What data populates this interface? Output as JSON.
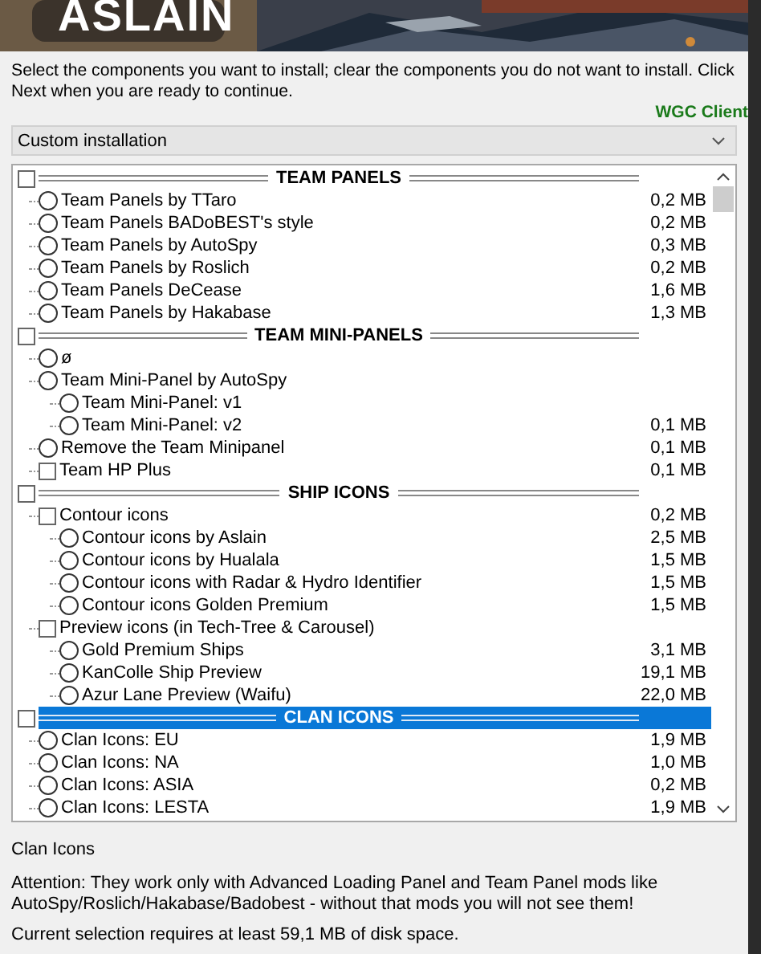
{
  "banner": {
    "kind": "picture",
    "logo": "ASLAIN"
  },
  "instructions": "Select the components you want to install; clear the components you do not want to install. Click Next when you are ready to continue.",
  "client_label": "WGC Client",
  "install_type": {
    "value": "Custom installation"
  },
  "components": [
    {
      "kind": "header",
      "label": "TEAM PANELS",
      "checked": false,
      "selected": false,
      "children": [
        {
          "kind": "radio",
          "label": "Team Panels by TTaro",
          "size": "0,2 MB",
          "checked": false,
          "selected": false
        },
        {
          "kind": "radio",
          "label": "Team Panels BADoBEST's style",
          "size": "0,2 MB",
          "checked": false,
          "selected": false
        },
        {
          "kind": "radio",
          "label": "Team Panels by AutoSpy",
          "size": "0,3 MB",
          "checked": false,
          "selected": false
        },
        {
          "kind": "radio",
          "label": "Team Panels by Roslich",
          "size": "0,2 MB",
          "checked": false,
          "selected": false
        },
        {
          "kind": "radio",
          "label": "Team Panels DeCease",
          "size": "1,6 MB",
          "checked": false,
          "selected": false
        },
        {
          "kind": "radio",
          "label": "Team Panels by Hakabase",
          "size": "1,3 MB",
          "checked": false,
          "selected": false
        }
      ]
    },
    {
      "kind": "header",
      "label": "TEAM MINI-PANELS",
      "checked": false,
      "selected": false,
      "children": [
        {
          "kind": "radio",
          "label": "ø",
          "checked": false,
          "selected": false
        },
        {
          "kind": "radio",
          "label": "Team Mini-Panel by AutoSpy",
          "checked": false,
          "selected": false,
          "children": [
            {
              "kind": "radio",
              "label": "Team Mini-Panel: v1",
              "checked": false,
              "selected": false
            },
            {
              "kind": "radio",
              "label": "Team Mini-Panel: v2",
              "size": "0,1 MB",
              "checked": false,
              "selected": false
            }
          ]
        },
        {
          "kind": "radio",
          "label": "Remove the Team Minipanel",
          "size": "0,1 MB",
          "checked": false,
          "selected": false
        },
        {
          "kind": "checkbox",
          "label": "Team HP Plus",
          "size": "0,1 MB",
          "checked": false,
          "selected": false
        }
      ]
    },
    {
      "kind": "header",
      "label": "SHIP ICONS",
      "checked": false,
      "selected": false,
      "children": [
        {
          "kind": "checkbox",
          "label": "Contour icons",
          "size": "0,2 MB",
          "checked": false,
          "selected": false,
          "children": [
            {
              "kind": "radio",
              "label": "Contour icons by Aslain",
              "size": "2,5 MB",
              "checked": false,
              "selected": false
            },
            {
              "kind": "radio",
              "label": "Contour icons by Hualala",
              "size": "1,5 MB",
              "checked": false,
              "selected": false
            },
            {
              "kind": "radio",
              "label": "Contour icons with Radar & Hydro Identifier",
              "size": "1,5 MB",
              "checked": false,
              "selected": false
            },
            {
              "kind": "radio",
              "label": "Contour icons Golden Premium",
              "size": "1,5 MB",
              "checked": false,
              "selected": false
            }
          ]
        },
        {
          "kind": "checkbox",
          "label": "Preview icons (in Tech-Tree & Carousel)",
          "checked": false,
          "selected": false,
          "children": [
            {
              "kind": "radio",
              "label": "Gold Premium Ships",
              "size": "3,1 MB",
              "checked": false,
              "selected": false
            },
            {
              "kind": "radio",
              "label": "KanColle Ship Preview",
              "size": "19,1 MB",
              "checked": false,
              "selected": false
            },
            {
              "kind": "radio",
              "label": "Azur Lane Preview (Waifu)",
              "size": "22,0 MB",
              "checked": false,
              "selected": false
            }
          ]
        }
      ]
    },
    {
      "kind": "header",
      "label": "CLAN ICONS",
      "checked": false,
      "selected": true,
      "children": [
        {
          "kind": "radio",
          "label": "Clan Icons: EU",
          "size": "1,9 MB",
          "checked": false,
          "selected": false
        },
        {
          "kind": "radio",
          "label": "Clan Icons: NA",
          "size": "1,0 MB",
          "checked": false,
          "selected": false
        },
        {
          "kind": "radio",
          "label": "Clan Icons: ASIA",
          "size": "0,2 MB",
          "checked": false,
          "selected": false
        },
        {
          "kind": "radio",
          "label": "Clan Icons: LESTA",
          "size": "1,9 MB",
          "checked": false,
          "selected": false
        }
      ]
    }
  ],
  "description_title": "Clan Icons",
  "description": "Attention: They work only with Advanced Loading Panel and Team Panel mods like AutoSpy/Roslich/Hakabase/Badobest - without that mods you will not see them!",
  "disk_space": "Current selection requires at least 59,1 MB of disk space."
}
